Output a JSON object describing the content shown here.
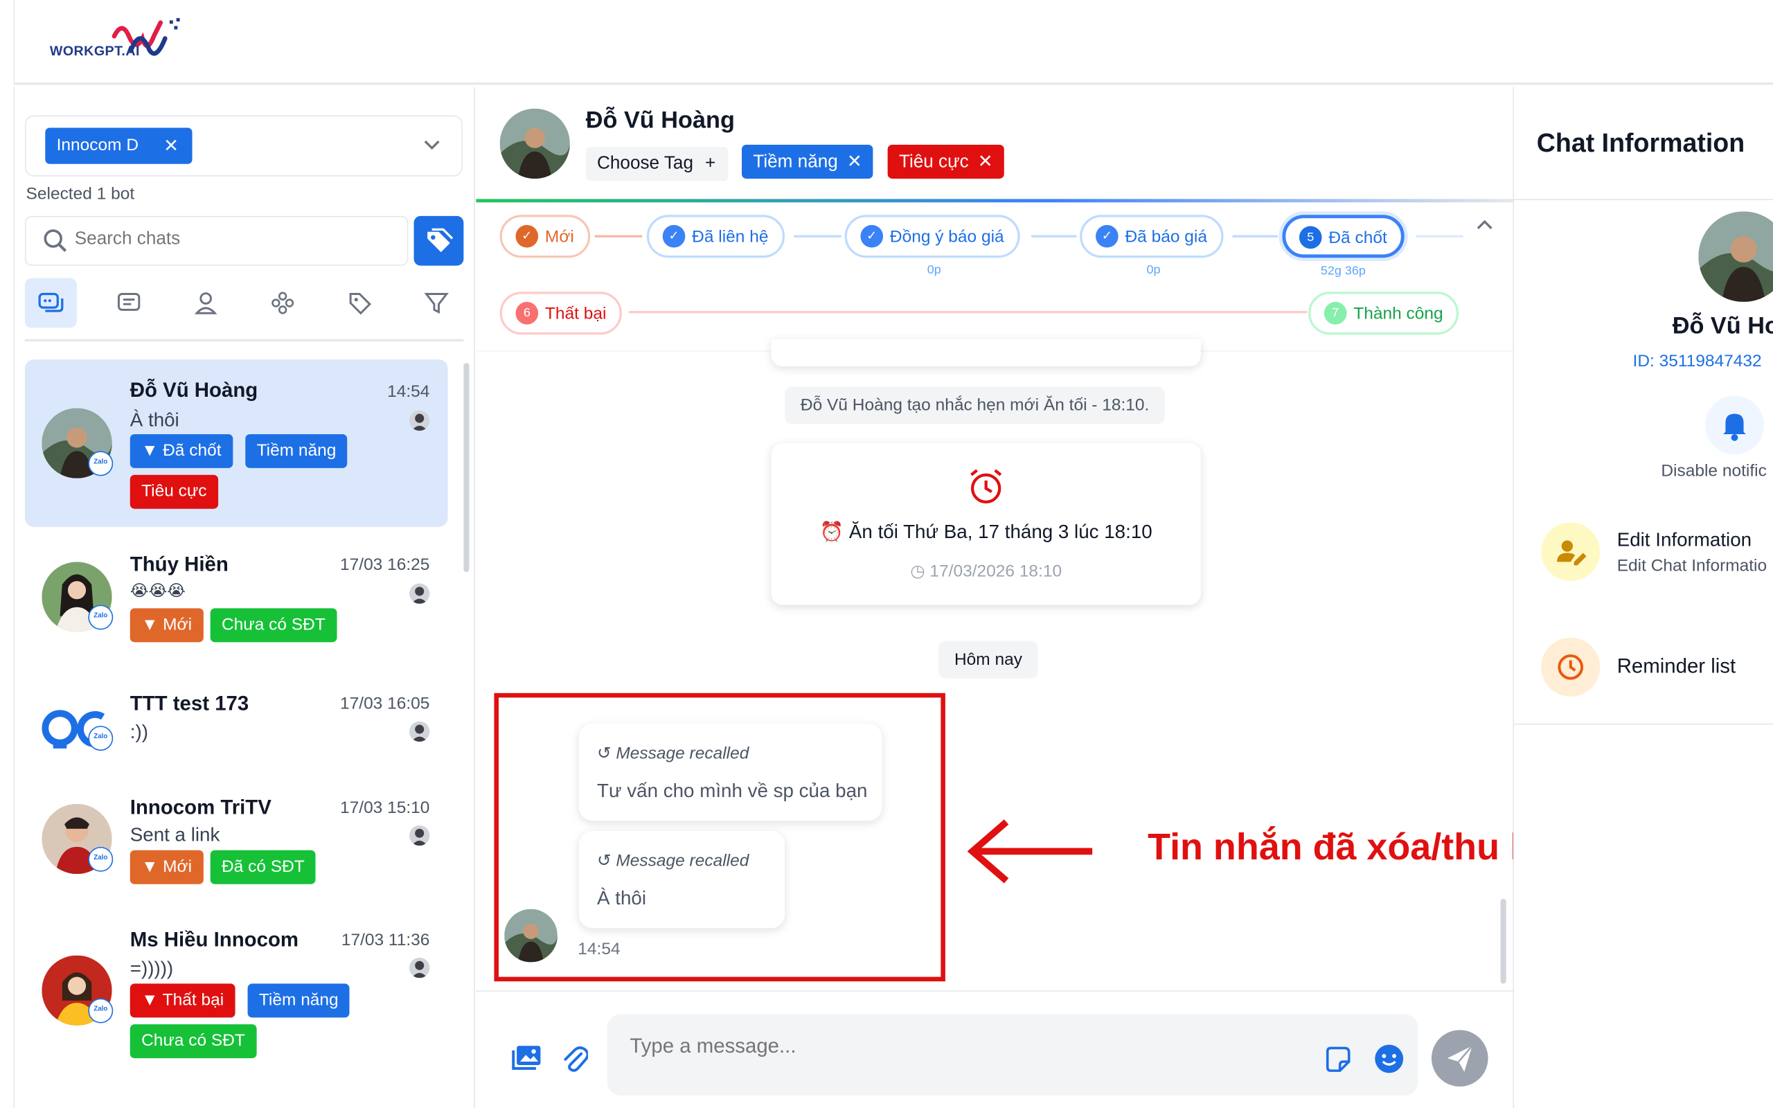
{
  "app": {
    "logo_text": "WORKGPT.AI"
  },
  "sidebar": {
    "bot_chip": "Innocom D",
    "selected_text": "Selected 1 bot",
    "search_placeholder": "Search chats",
    "chats": [
      {
        "name": "Đỗ Vũ Hoàng",
        "time": "14:54",
        "last": "À thôi",
        "tags": [
          "▼ Đã chốt",
          "Tiềm năng",
          "Tiêu cực"
        ]
      },
      {
        "name": "Thúy Hiền",
        "time": "17/03 16:25",
        "last": "😭😭😭",
        "tags": [
          "▼ Mới",
          "Chưa có SĐT"
        ]
      },
      {
        "name": "TTT test 173",
        "time": "17/03 16:05",
        "last": ":))",
        "tags": []
      },
      {
        "name": "Innocom TriTV",
        "time": "17/03 15:10",
        "last": "Sent a link",
        "tags": [
          "▼ Mới",
          "Đã có SĐT"
        ]
      },
      {
        "name": "Ms Hiều Innocom",
        "time": "17/03 11:36",
        "last": "=)))))",
        "tags": [
          "▼ Thất bại",
          "Tiềm năng",
          "Chưa có SĐT"
        ]
      }
    ],
    "zalo_label": "Zalo"
  },
  "chat": {
    "contact_name": "Đỗ Vũ Hoàng",
    "choose_tag": "Choose Tag",
    "tags": [
      "Tiềm năng",
      "Tiêu cực"
    ],
    "stages": [
      {
        "label": "Mới",
        "sub": ""
      },
      {
        "label": "Đã liên hệ",
        "sub": ""
      },
      {
        "label": "Đồng ý báo giá",
        "sub": "0p"
      },
      {
        "label": "Đã báo giá",
        "sub": "0p"
      },
      {
        "num": "5",
        "label": "Đã chốt",
        "sub": "52g 36p"
      }
    ],
    "stage_fail": {
      "num": "6",
      "label": "Thất bại"
    },
    "stage_success": {
      "num": "7",
      "label": "Thành công"
    },
    "system_msg": "Đỗ Vũ Hoàng tạo nhắc hẹn mới Ăn tối - 18:10.",
    "reminder": {
      "title": "⏰ Ăn tối Thứ Ba, 17 tháng 3 lúc 18:10",
      "datetime": "17/03/2026 18:10"
    },
    "day_label": "Hôm nay",
    "recalled": [
      {
        "head": "Message recalled",
        "body": "Tư vấn cho mình về sp của bạn"
      },
      {
        "head": "Message recalled",
        "body": "À thôi"
      }
    ],
    "msg_time": "14:54",
    "input_placeholder": "Type a message..."
  },
  "annotation": {
    "text": "Tin nhắn đã xóa/thu hồi",
    "color": "#e01010"
  },
  "info": {
    "title": "Chat Information",
    "name": "Đỗ Vũ Ho",
    "id": "ID: 35119847432",
    "disable_notif": "Disable notific",
    "edit_title": "Edit Information",
    "edit_sub": "Edit Chat Informatio",
    "reminder_list": "Reminder list"
  },
  "colors": {
    "accent": "#1d6fe6",
    "danger": "#e01010",
    "success": "#16c138",
    "orange": "#e0672a"
  }
}
